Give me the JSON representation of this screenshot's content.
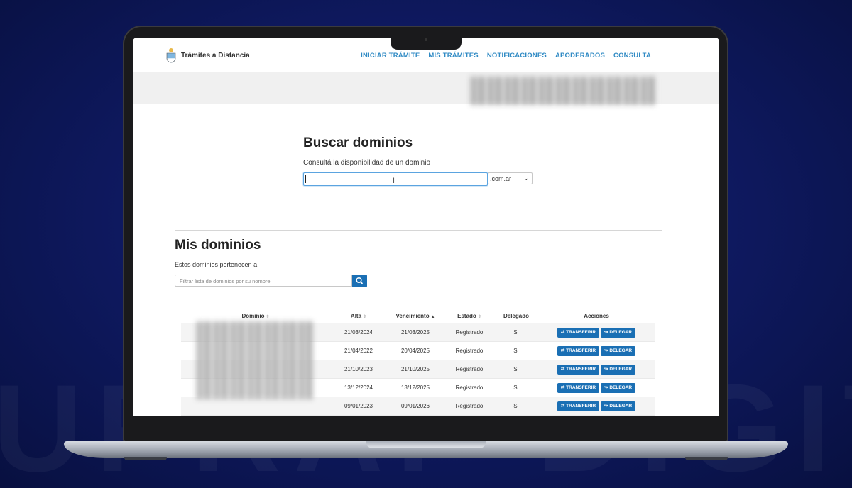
{
  "watermark": "UPRAP DIGITAL",
  "site": {
    "brand": "Trámites a Distancia"
  },
  "nav": [
    "INICIAR TRÁMITE",
    "MIS TRÁMITES",
    "NOTIFICACIONES",
    "APODERADOS",
    "CONSULTA"
  ],
  "search": {
    "title": "Buscar dominios",
    "subtitle": "Consultá la disponibilidad de un dominio",
    "value": "",
    "tld": ".com.ar"
  },
  "mine": {
    "title": "Mis dominios",
    "subtitle": "Estos dominios pertenecen a",
    "filter_placeholder": "Filtrar lista de dominios por su nombre"
  },
  "table": {
    "headers": [
      "Dominio",
      "Alta",
      "Vencimiento",
      "Estado",
      "Delegado",
      "Acciones"
    ],
    "rows": [
      [
        "",
        "21/03/2024",
        "21/03/2025",
        "Registrado",
        "SI"
      ],
      [
        "",
        "21/04/2022",
        "20/04/2025",
        "Registrado",
        "SI"
      ],
      [
        "",
        "21/10/2023",
        "21/10/2025",
        "Registrado",
        "SI"
      ],
      [
        "",
        "13/12/2024",
        "13/12/2025",
        "Registrado",
        "SI"
      ],
      [
        "",
        "09/01/2023",
        "09/01/2026",
        "Registrado",
        "SI"
      ]
    ],
    "transfer_label": "TRANSFERIR",
    "delegate_label": "DELEGAR"
  },
  "colors": {
    "accent": "#1a6fb4",
    "nav": "#2f8ac4",
    "background": "#0f1a63"
  }
}
